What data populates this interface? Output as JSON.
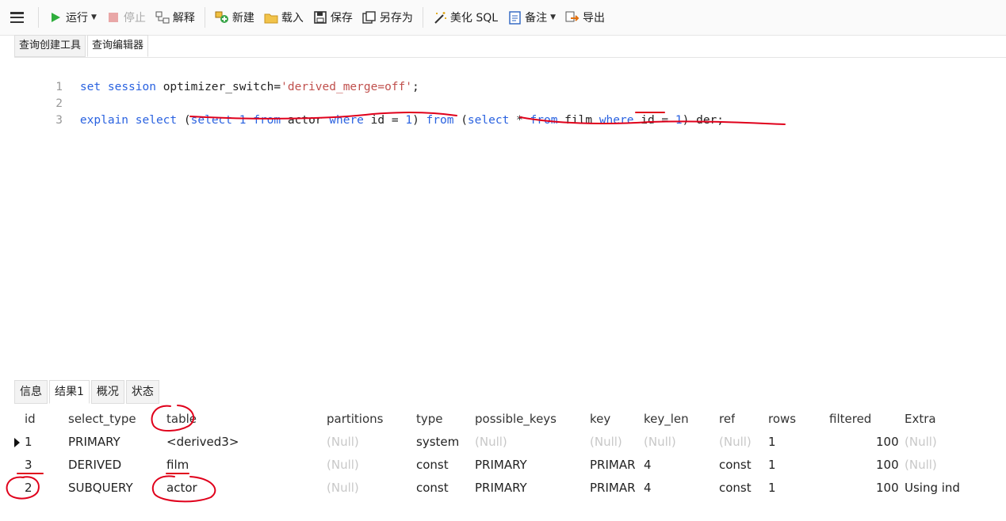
{
  "toolbar": {
    "run_label": "运行",
    "stop_label": "停止",
    "explain_label": "解释",
    "new_label": "新建",
    "load_label": "载入",
    "save_label": "保存",
    "save_as_label": "另存为",
    "beautify_label": "美化 SQL",
    "note_label": "备注",
    "export_label": "导出"
  },
  "top_tabs": [
    "查询创建工具",
    "查询编辑器"
  ],
  "editor": {
    "line_numbers": [
      "1",
      "2",
      "3"
    ],
    "line1": {
      "kw1": "set",
      "kw2": "session",
      "ident": "optimizer_switch",
      "eq": "=",
      "str": "'derived_merge=off'",
      "semi": ";"
    },
    "line3": {
      "t1": "explain",
      "t2": "select",
      "t3": "(",
      "t4": "select",
      "t5": "1",
      "t6": "from",
      "t7": "actor",
      "t8": "where",
      "t9": "id",
      "t10": "=",
      "t11": "1",
      "t12": ")",
      "t13": "from",
      "t14": "(",
      "t15": "select",
      "t16": "*",
      "t17": "from",
      "t18": "film",
      "t19": "where",
      "t20": "id",
      "t21": "=",
      "t22": "1",
      "t23": ")",
      "t24": "der;"
    }
  },
  "bottom_tabs": [
    "信息",
    "结果1",
    "概况",
    "状态"
  ],
  "results": {
    "columns": [
      "id",
      "select_type",
      "table",
      "partitions",
      "type",
      "possible_keys",
      "key",
      "key_len",
      "ref",
      "rows",
      "filtered",
      "Extra"
    ],
    "rows": [
      [
        "1",
        "PRIMARY",
        "<derived3>",
        "(Null)",
        "system",
        "(Null)",
        "(Null)",
        "(Null)",
        "(Null)",
        "1",
        "100",
        "(Null)"
      ],
      [
        "3",
        "DERIVED",
        "film",
        "(Null)",
        "const",
        "PRIMARY",
        "PRIMAR",
        "4",
        "const",
        "1",
        "100",
        "(Null)"
      ],
      [
        "2",
        "SUBQUERY",
        "actor",
        "(Null)",
        "const",
        "PRIMARY",
        "PRIMAR",
        "4",
        "const",
        "1",
        "100",
        "Using ind"
      ]
    ]
  },
  "colors": {
    "keyword": "#2a62e0",
    "string": "#c0504d",
    "annotation": "#e0001b",
    "null": "#c8c8c8"
  }
}
